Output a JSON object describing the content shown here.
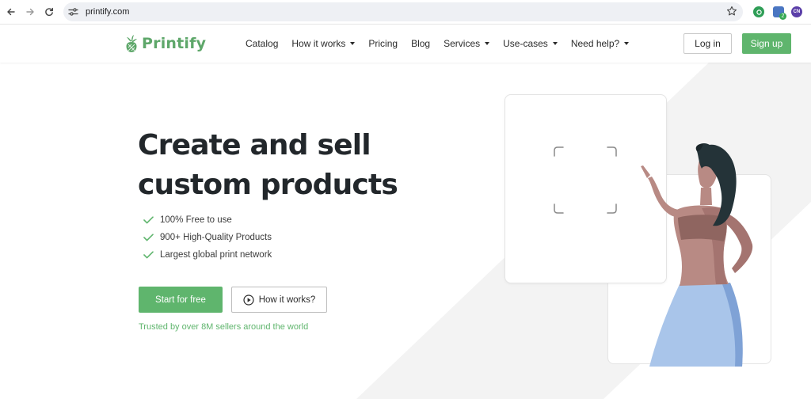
{
  "browser": {
    "url": "printify.com",
    "extension_badge": "2",
    "profile_initials": "CN"
  },
  "header": {
    "logo_text": "Printify",
    "nav": [
      {
        "label": "Catalog",
        "dropdown": false
      },
      {
        "label": "How it works",
        "dropdown": true
      },
      {
        "label": "Pricing",
        "dropdown": false
      },
      {
        "label": "Blog",
        "dropdown": false
      },
      {
        "label": "Services",
        "dropdown": true
      },
      {
        "label": "Use-cases",
        "dropdown": true
      },
      {
        "label": "Need help?",
        "dropdown": true
      }
    ],
    "login_label": "Log in",
    "signup_label": "Sign up"
  },
  "hero": {
    "headline_line1": "Create and sell",
    "headline_line2": "custom products",
    "benefits": [
      "100% Free to use",
      "900+ High-Quality Products",
      "Largest global print network"
    ],
    "cta_primary": "Start for free",
    "cta_secondary": "How it works?",
    "trusted_text": "Trusted by over 8M sellers around the world"
  },
  "colors": {
    "brand_green": "#5fb56d",
    "headline": "#22272b",
    "skin": "#b88a84",
    "hair": "#243338",
    "skirt": "#a9c5ea"
  }
}
